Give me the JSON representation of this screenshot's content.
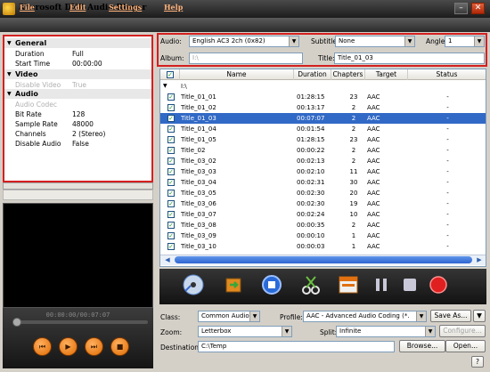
{
  "app": {
    "title": "3herosoft DVD Audio Ripper"
  },
  "menu": [
    "File",
    "Edit",
    "Settings",
    "Help"
  ],
  "properties": {
    "general": {
      "title": "General",
      "rows": [
        {
          "k": "Duration",
          "v": "Full"
        },
        {
          "k": "Start Time",
          "v": "00:00:00"
        }
      ]
    },
    "video": {
      "title": "Video",
      "rows": [
        {
          "k": "Disable Video",
          "v": "True"
        }
      ]
    },
    "audio": {
      "title": "Audio",
      "rows": [
        {
          "k": "Audio Codec",
          "v": ""
        },
        {
          "k": "Bit Rate",
          "v": "128"
        },
        {
          "k": "Sample Rate",
          "v": "48000"
        },
        {
          "k": "Channels",
          "v": "2 (Stereo)"
        },
        {
          "k": "Disable Audio",
          "v": "False"
        }
      ]
    }
  },
  "player": {
    "time": "00:00:00/00:07:07"
  },
  "options": {
    "audio_label": "Audio:",
    "audio_value": "English AC3 2ch (0x82)",
    "subtitle_label": "Subtitle:",
    "subtitle_value": "None",
    "angle_label": "Angle:",
    "angle_value": "1",
    "album_label": "Album:",
    "album_placeholder": "I:\\",
    "title_label": "Title:",
    "title_value": "Title_01_03"
  },
  "table": {
    "columns": [
      "Name",
      "Duration",
      "Chapters",
      "Target",
      "Status"
    ],
    "root": "I:\\",
    "rows": [
      [
        "Title_01_01",
        "01:28:15",
        "23",
        "AAC",
        "-"
      ],
      [
        "Title_01_02",
        "00:13:17",
        "2",
        "AAC",
        "-"
      ],
      [
        "Title_01_03",
        "00:07:07",
        "2",
        "AAC",
        "-"
      ],
      [
        "Title_01_04",
        "00:01:54",
        "2",
        "AAC",
        "-"
      ],
      [
        "Title_01_05",
        "01:28:15",
        "23",
        "AAC",
        "-"
      ],
      [
        "Title_02",
        "00:00:22",
        "2",
        "AAC",
        "-"
      ],
      [
        "Title_03_02",
        "00:02:13",
        "2",
        "AAC",
        "-"
      ],
      [
        "Title_03_03",
        "00:02:10",
        "11",
        "AAC",
        "-"
      ],
      [
        "Title_03_04",
        "00:02:31",
        "30",
        "AAC",
        "-"
      ],
      [
        "Title_03_05",
        "00:02:30",
        "20",
        "AAC",
        "-"
      ],
      [
        "Title_03_06",
        "00:02:30",
        "19",
        "AAC",
        "-"
      ],
      [
        "Title_03_07",
        "00:02:24",
        "10",
        "AAC",
        "-"
      ],
      [
        "Title_03_08",
        "00:00:35",
        "2",
        "AAC",
        "-"
      ],
      [
        "Title_03_09",
        "00:00:10",
        "1",
        "AAC",
        "-"
      ],
      [
        "Title_03_10",
        "00:00:03",
        "1",
        "AAC",
        "-"
      ],
      [
        "Title_03_11",
        "00:00:02",
        "1",
        "AAC",
        "-"
      ]
    ],
    "selected_index": 2
  },
  "bottom": {
    "class_label": "Class:",
    "class_value": "Common Audio",
    "profile_label": "Profile:",
    "profile_value": "AAC - Advanced Audio Coding  (*.",
    "save_as": "Save As...",
    "zoom_label": "Zoom:",
    "zoom_value": "Letterbox",
    "split_label": "Split:",
    "split_value": "Infinite",
    "configure": "Configure...",
    "dest_label": "Destination:",
    "dest_value": "C:\\Temp",
    "browse": "Browse...",
    "open": "Open...",
    "help": "?"
  }
}
